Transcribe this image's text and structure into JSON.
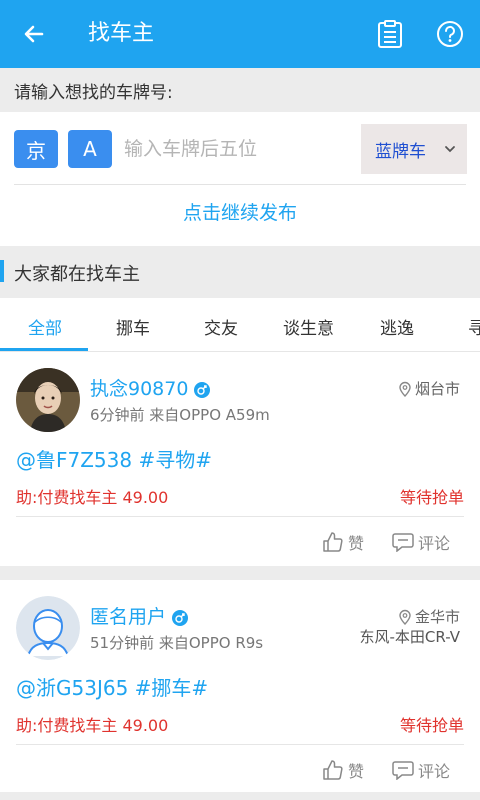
{
  "header": {
    "title": "找车主",
    "back_icon": "arrow-left-icon",
    "clipboard_icon": "clipboard-icon",
    "help_icon": "help-circle-icon"
  },
  "form": {
    "prompt": "请输入想找的车牌号:",
    "province": "京",
    "letter": "A",
    "plate_placeholder": "输入车牌后五位",
    "plate_value": "",
    "plate_color": "蓝牌车",
    "continue_label": "点击继续发布"
  },
  "section": {
    "title": "大家都在找车主"
  },
  "tabs": [
    {
      "label": "全部",
      "active": true
    },
    {
      "label": "挪车",
      "active": false
    },
    {
      "label": "交友",
      "active": false
    },
    {
      "label": "谈生意",
      "active": false
    },
    {
      "label": "逃逸",
      "active": false
    },
    {
      "label": "寻",
      "active": false
    }
  ],
  "posts": [
    {
      "username": "执念90870",
      "gender": "male",
      "meta": "6分钟前 来自OPPO A59m",
      "location": "烟台市",
      "car": "",
      "tagline": "@鲁F7Z538 #寻物#",
      "reward": "助:付费找车主  49.00",
      "status": "等待抢单",
      "like_label": "赞",
      "comment_label": "评论"
    },
    {
      "username": "匿名用户",
      "gender": "male",
      "meta": "51分钟前 来自OPPO R9s",
      "location": "金华市",
      "car": "东风-本田CR-V",
      "tagline": "@浙G53J65 #挪车#",
      "reward": "助:付费找车主  49.00",
      "status": "等待抢单",
      "like_label": "赞",
      "comment_label": "评论"
    }
  ],
  "colors": {
    "primary": "#1fa4f0",
    "chip": "#3a8eef",
    "danger": "#e0332e",
    "plate_blue": "#1f4fd1"
  }
}
